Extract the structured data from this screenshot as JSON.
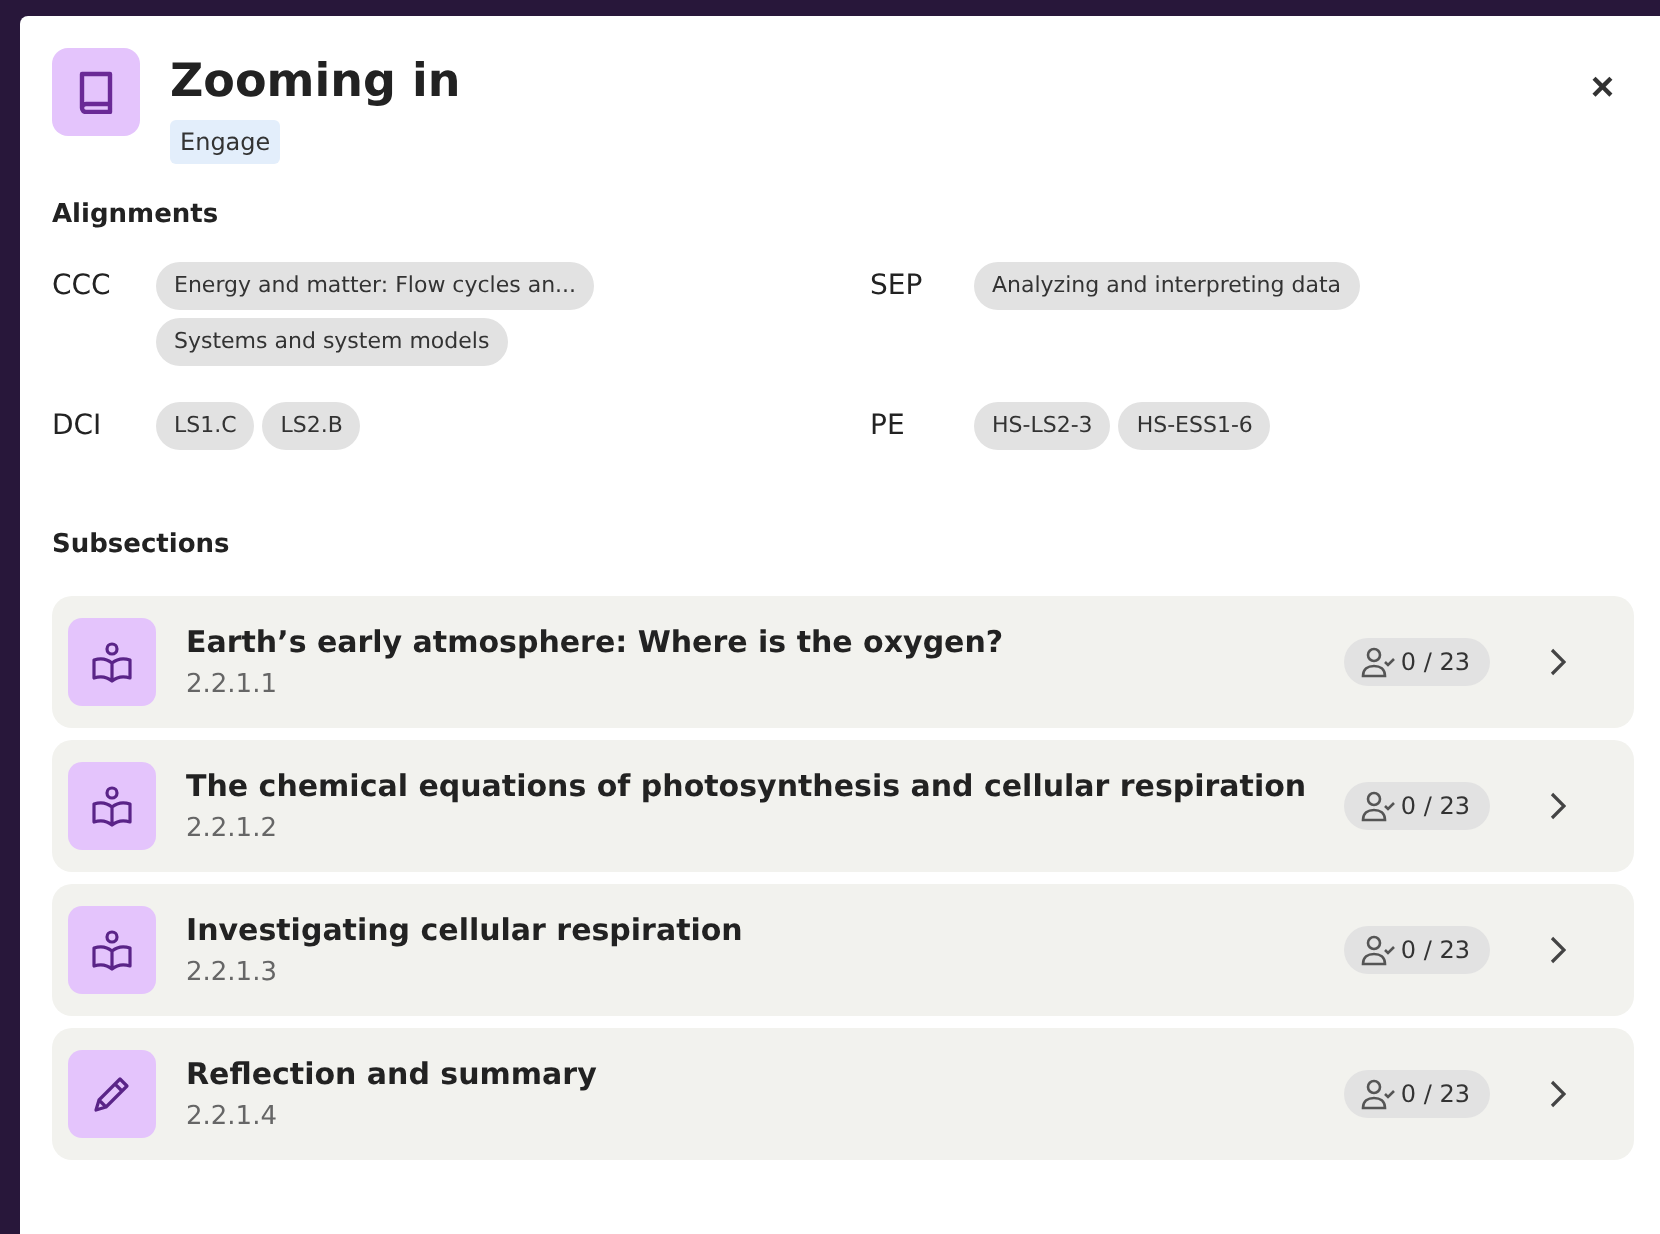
{
  "header": {
    "title": "Zooming in",
    "tag": "Engage",
    "close": "×"
  },
  "alignments": {
    "heading": "Alignments",
    "groups": [
      {
        "label": "CCC",
        "chips": [
          "Energy and matter: Flow cycles an...",
          "Systems and system models"
        ]
      },
      {
        "label": "SEP",
        "chips": [
          "Analyzing and interpreting data"
        ]
      },
      {
        "label": "DCI",
        "chips": [
          "LS1.C",
          "LS2.B"
        ]
      },
      {
        "label": "PE",
        "chips": [
          "HS-LS2-3",
          "HS-ESS1-6"
        ]
      }
    ]
  },
  "subsections": {
    "heading": "Subsections",
    "items": [
      {
        "kind": "reading",
        "title": "Earth’s early atmosphere: Where is the oxygen?",
        "number": "2.2.1.1",
        "progress": "0 / 23"
      },
      {
        "kind": "reading",
        "title": "The chemical equations of photosynthesis and cellular respiration",
        "number": "2.2.1.2",
        "progress": "0 / 23"
      },
      {
        "kind": "reading",
        "title": "Investigating cellular respiration",
        "number": "2.2.1.3",
        "progress": "0 / 23"
      },
      {
        "kind": "writing",
        "title": "Reflection and summary",
        "number": "2.2.1.4",
        "progress": "0 / 23"
      }
    ]
  }
}
